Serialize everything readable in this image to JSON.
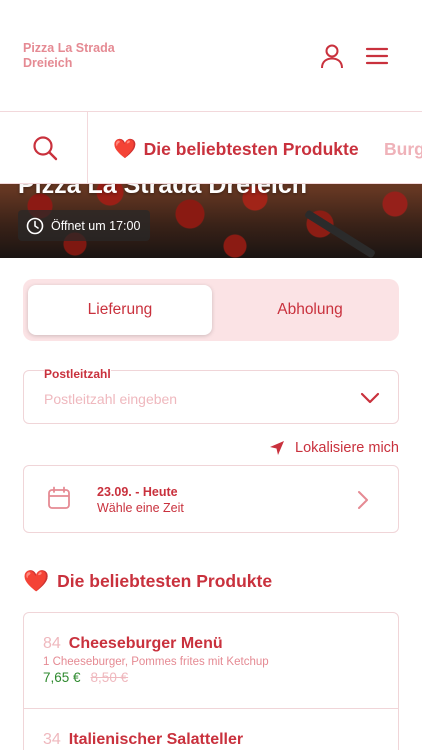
{
  "header": {
    "brand_line1": "Pizza La Strada",
    "brand_line2": "Dreieich",
    "user_icon": "user-icon",
    "menu_icon": "hamburger-menu-icon"
  },
  "categories": {
    "search_icon": "search-icon",
    "active": {
      "icon": "heart",
      "label": "Die beliebtesten Produkte"
    },
    "next_label": "Burg"
  },
  "hero": {
    "title": "Pizza La Strada Dreieich",
    "open_text": "Öffnet um 17:00"
  },
  "delivery_mode": {
    "options": [
      "Lieferung",
      "Abholung"
    ],
    "selected": "Lieferung"
  },
  "postal": {
    "label": "Postleitzahl",
    "placeholder": "Postleitzahl eingeben",
    "value": ""
  },
  "locate_label": "Lokalisiere mich",
  "date": {
    "main": "23.09. - Heute",
    "sub": "Wähle eine Zeit"
  },
  "section": {
    "icon": "heart",
    "title": "Die beliebtesten Produkte"
  },
  "products": [
    {
      "number": "84",
      "name": "Cheeseburger Menü",
      "description": "1 Cheeseburger, Pommes frites mit Ketchup",
      "price": "7,65 €",
      "old_price": "8,50 €"
    },
    {
      "number": "34",
      "name": "Italienischer Salatteller"
    }
  ],
  "colors": {
    "accent": "#c9313d",
    "accent_light": "#fbe3e5",
    "price_green": "#2f8a2f"
  }
}
